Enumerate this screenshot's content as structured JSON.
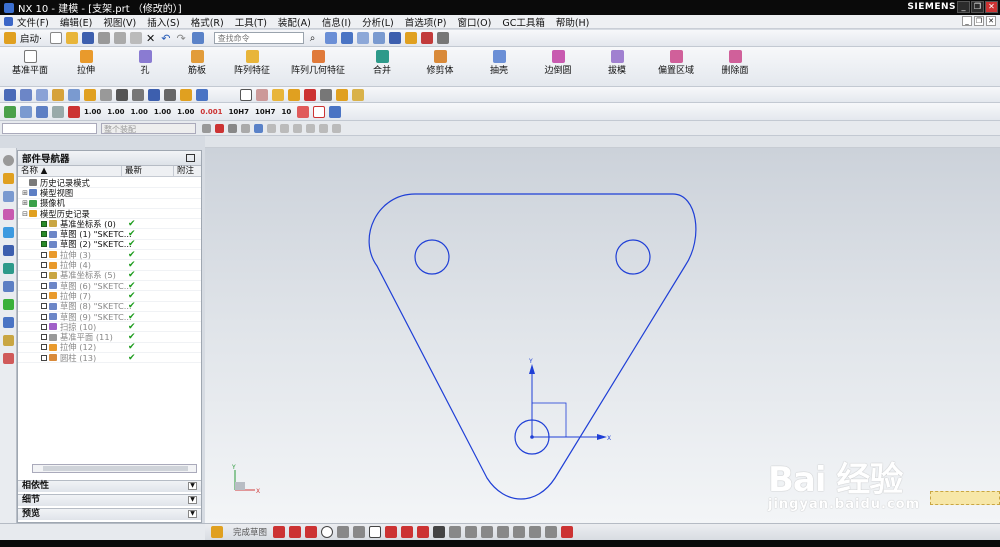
{
  "window": {
    "title": "NX 10 - 建模 - [支架.prt （修改的）]",
    "brand": "SIEMENS"
  },
  "menu": [
    "文件(F)",
    "编辑(E)",
    "视图(V)",
    "插入(S)",
    "格式(R)",
    "工具(T)",
    "装配(A)",
    "信息(I)",
    "分析(L)",
    "首选项(P)",
    "窗口(O)",
    "GC工具箱",
    "帮助(H)"
  ],
  "toolbar": {
    "start_label": "启动·",
    "search_placeholder": "查找命令"
  },
  "features": [
    "基准平面",
    "拉伸",
    "孔",
    "筋板",
    "阵列特征",
    "阵列几何特征",
    "合并",
    "修剪体",
    "抽壳",
    "边倒圆",
    "拔模",
    "偏置区域",
    "删除面"
  ],
  "snap_values": [
    "1.00",
    "1.00",
    "1.00",
    "1.00",
    "1.00",
    "0.001",
    "10H7",
    "10H7",
    "10"
  ],
  "filter": {
    "select_placeholder": "整个装配"
  },
  "navigator": {
    "title": "部件导航器",
    "columns": [
      "名称",
      "最新",
      "附注"
    ],
    "rows": [
      {
        "label": "历史记录模式",
        "indent": 0,
        "tri": "",
        "cb": false,
        "dim": false,
        "check": false
      },
      {
        "label": "模型视图",
        "indent": 0,
        "tri": "+",
        "cb": false,
        "dim": false,
        "check": false
      },
      {
        "label": "摄像机",
        "indent": 0,
        "tri": "+",
        "cb": false,
        "dim": false,
        "check": false
      },
      {
        "label": "模型历史记录",
        "indent": 0,
        "tri": "-",
        "cb": false,
        "dim": false,
        "check": false
      },
      {
        "label": "基准坐标系 (0)",
        "indent": 1,
        "tri": "",
        "cb": true,
        "dim": false,
        "check": true
      },
      {
        "label": "草图 (1) \"SKETC...",
        "indent": 1,
        "tri": "",
        "cb": true,
        "dim": false,
        "check": true
      },
      {
        "label": "草图 (2) \"SKETC...",
        "indent": 1,
        "tri": "",
        "cb": true,
        "dim": false,
        "check": true
      },
      {
        "label": "拉伸 (3)",
        "indent": 1,
        "tri": "",
        "cb": false,
        "dim": true,
        "check": true
      },
      {
        "label": "拉伸 (4)",
        "indent": 1,
        "tri": "",
        "cb": false,
        "dim": true,
        "check": true
      },
      {
        "label": "基准坐标系 (5)",
        "indent": 1,
        "tri": "",
        "cb": false,
        "dim": true,
        "check": true
      },
      {
        "label": "草图 (6) \"SKETC...",
        "indent": 1,
        "tri": "",
        "cb": false,
        "dim": true,
        "check": true
      },
      {
        "label": "拉伸 (7)",
        "indent": 1,
        "tri": "",
        "cb": false,
        "dim": true,
        "check": true
      },
      {
        "label": "草图 (8) \"SKETC...",
        "indent": 1,
        "tri": "",
        "cb": false,
        "dim": true,
        "check": true
      },
      {
        "label": "草图 (9) \"SKETC...",
        "indent": 1,
        "tri": "",
        "cb": false,
        "dim": true,
        "check": true
      },
      {
        "label": "扫掠 (10)",
        "indent": 1,
        "tri": "",
        "cb": false,
        "dim": true,
        "check": true
      },
      {
        "label": "基准平面 (11)",
        "indent": 1,
        "tri": "",
        "cb": false,
        "dim": true,
        "check": true
      },
      {
        "label": "拉伸 (12)",
        "indent": 1,
        "tri": "",
        "cb": false,
        "dim": true,
        "check": true
      },
      {
        "label": "圆柱 (13)",
        "indent": 1,
        "tri": "",
        "cb": false,
        "dim": true,
        "check": true
      }
    ],
    "panels": [
      "相依性",
      "细节",
      "预览"
    ]
  },
  "axes": {
    "x": "X",
    "y": "Y"
  },
  "bottom": {
    "finish_sketch": "完成草图"
  },
  "watermark": {
    "line1": "Bai 经验",
    "line2": "jingyan.baidu.com"
  },
  "colors": {
    "sketch": "#1f3fd6",
    "check": "#1b9b1b",
    "titlebar": "#0a0a0a"
  }
}
